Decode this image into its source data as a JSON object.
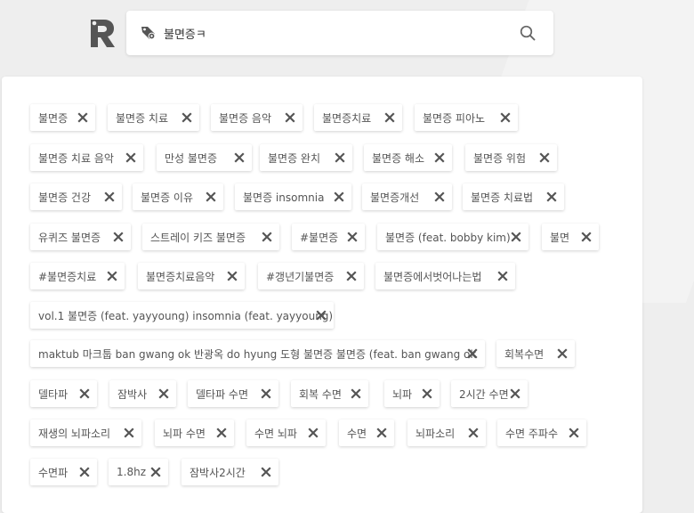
{
  "search": {
    "value": "불면증ㅋ"
  },
  "tags": [
    {
      "label": "불면증"
    },
    {
      "label": "불면증 치료"
    },
    {
      "label": "불면증 음악"
    },
    {
      "label": "불면증치료"
    },
    {
      "label": "불면증 피아노"
    },
    {
      "label": "불면증 치료 음악"
    },
    {
      "label": "만성 불면증"
    },
    {
      "label": "불면증 완치"
    },
    {
      "label": "불면증 해소"
    },
    {
      "label": "불면증 위험"
    },
    {
      "label": "불면증 건강"
    },
    {
      "label": "불면증 이유"
    },
    {
      "label": "불면증 insomnia"
    },
    {
      "label": "불면증개선"
    },
    {
      "label": "불면증 치료법"
    },
    {
      "label": "유퀴즈 불면증"
    },
    {
      "label": "스트레이 키즈 불면증"
    },
    {
      "label": "#불면증"
    },
    {
      "label": "불면증 (feat. bobby kim)"
    },
    {
      "label": "불면"
    },
    {
      "label": "#불면증치료"
    },
    {
      "label": "불면증치료음악"
    },
    {
      "label": "#갱년기불면증"
    },
    {
      "label": "불면증에서벗어나는법"
    },
    {
      "label": "vol.1 불면증 (feat. yayyoung) insomnia (feat. yayyoung)"
    },
    {
      "label": "maktub 마크툽 ban gwang ok 반광옥 do hyung 도형 불면증 불면증 (feat. ban gwang ok"
    },
    {
      "label": "회복수면"
    },
    {
      "label": "델타파"
    },
    {
      "label": "잠박사"
    },
    {
      "label": "델타파 수면"
    },
    {
      "label": "회복 수면"
    },
    {
      "label": "뇌파"
    },
    {
      "label": "2시간 수면"
    },
    {
      "label": "재생의 뇌파소리"
    },
    {
      "label": "뇌파 수면"
    },
    {
      "label": "수면 뇌파"
    },
    {
      "label": "수면"
    },
    {
      "label": "뇌파소리"
    },
    {
      "label": "수면 주파수"
    },
    {
      "label": "수면파"
    },
    {
      "label": "1.8hz"
    },
    {
      "label": "잠박사2시간"
    }
  ]
}
